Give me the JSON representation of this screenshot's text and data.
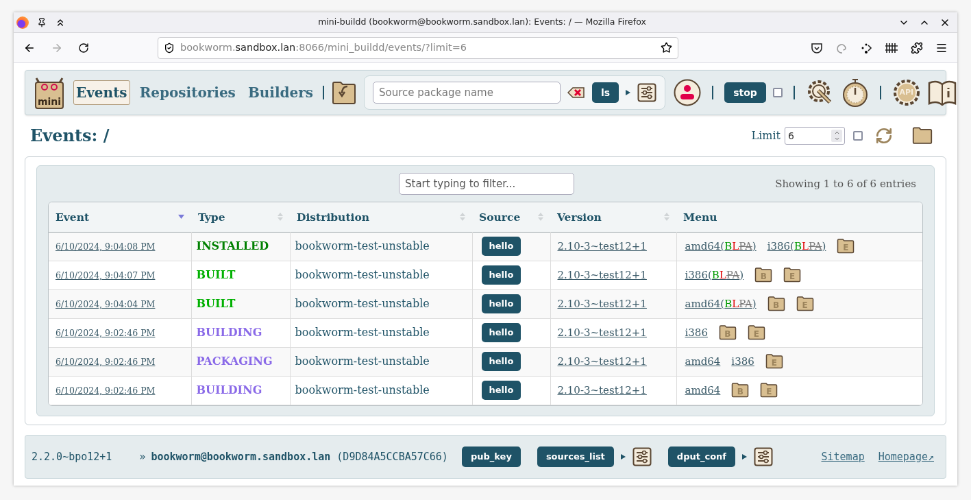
{
  "window": {
    "title": "mini-buildd (bookworm@bookworm.sandbox.lan): Events: / — Mozilla Firefox"
  },
  "browser": {
    "url_parts": [
      {
        "text": "bookworm.",
        "kind": "dim"
      },
      {
        "text": "sandbox.lan",
        "kind": "host"
      },
      {
        "text": ":8066/mini_buildd/events/?limit=6",
        "kind": "dim"
      }
    ]
  },
  "header": {
    "logo_text": "mini",
    "nav": [
      {
        "label": "Events",
        "selected": true
      },
      {
        "label": "Repositories",
        "selected": false
      },
      {
        "label": "Builders",
        "selected": false
      }
    ],
    "search": {
      "placeholder": "Source package name"
    },
    "ls_button": "ls",
    "stop_button": "stop",
    "stop_checked": false,
    "api_label": "API"
  },
  "page_title": "Events: /",
  "limit": {
    "label": "Limit",
    "value": "6",
    "checked": false
  },
  "table": {
    "filter_placeholder": "Start typing to filter...",
    "info": "Showing 1 to 6 of 6 entries",
    "columns": [
      {
        "label": "Event",
        "sortable": true,
        "sorted_desc": true
      },
      {
        "label": "Type",
        "sortable": true,
        "sorted_desc": false
      },
      {
        "label": "Distribution",
        "sortable": true,
        "sorted_desc": false
      },
      {
        "label": "Source",
        "sortable": true,
        "sorted_desc": false
      },
      {
        "label": "Version",
        "sortable": true,
        "sorted_desc": false
      },
      {
        "label": "Menu",
        "sortable": false
      }
    ],
    "rows": [
      {
        "event": "6/10/2024, 9:04:08 PM",
        "type": "INSTALLED",
        "color": "#008000",
        "distribution": "bookworm-test-unstable",
        "source": "hello",
        "version": "2.10-3~test12+1",
        "menu": [
          {
            "kind": "arch",
            "parts": [
              {
                "text": "amd64(",
                "kind": "plain"
              },
              {
                "text": "B",
                "kind": "ok"
              },
              {
                "text": "L",
                "kind": "fail"
              },
              {
                "text": "PA",
                "kind": "skip"
              },
              {
                "text": ")",
                "kind": "plain"
              }
            ]
          },
          {
            "kind": "arch",
            "parts": [
              {
                "text": "i386(",
                "kind": "plain"
              },
              {
                "text": "B",
                "kind": "ok"
              },
              {
                "text": "L",
                "kind": "fail"
              },
              {
                "text": "PA",
                "kind": "skip"
              },
              {
                "text": ")",
                "kind": "plain"
              }
            ]
          },
          {
            "kind": "folder",
            "letter": "E"
          }
        ]
      },
      {
        "event": "6/10/2024, 9:04:07 PM",
        "type": "BUILT",
        "color": "#00b000",
        "distribution": "bookworm-test-unstable",
        "source": "hello",
        "version": "2.10-3~test12+1",
        "menu": [
          {
            "kind": "arch",
            "parts": [
              {
                "text": "i386(",
                "kind": "plain"
              },
              {
                "text": "B",
                "kind": "ok"
              },
              {
                "text": "L",
                "kind": "fail"
              },
              {
                "text": "PA",
                "kind": "skip"
              },
              {
                "text": ")",
                "kind": "plain"
              }
            ]
          },
          {
            "kind": "folder",
            "letter": "B"
          },
          {
            "kind": "folder",
            "letter": "E"
          }
        ]
      },
      {
        "event": "6/10/2024, 9:04:04 PM",
        "type": "BUILT",
        "color": "#00b000",
        "distribution": "bookworm-test-unstable",
        "source": "hello",
        "version": "2.10-3~test12+1",
        "menu": [
          {
            "kind": "arch",
            "parts": [
              {
                "text": "amd64(",
                "kind": "plain"
              },
              {
                "text": "B",
                "kind": "ok"
              },
              {
                "text": "L",
                "kind": "fail"
              },
              {
                "text": "PA",
                "kind": "skip"
              },
              {
                "text": ")",
                "kind": "plain"
              }
            ]
          },
          {
            "kind": "folder",
            "letter": "B"
          },
          {
            "kind": "folder",
            "letter": "E"
          }
        ]
      },
      {
        "event": "6/10/2024, 9:02:46 PM",
        "type": "BUILDING",
        "color": "#8a6ae8",
        "distribution": "bookworm-test-unstable",
        "source": "hello",
        "version": "2.10-3~test12+1",
        "menu": [
          {
            "kind": "arch",
            "parts": [
              {
                "text": "i386",
                "kind": "plain"
              }
            ]
          },
          {
            "kind": "folder",
            "letter": "B"
          },
          {
            "kind": "folder",
            "letter": "E"
          }
        ]
      },
      {
        "event": "6/10/2024, 9:02:46 PM",
        "type": "PACKAGING",
        "color": "#8a6ae8",
        "distribution": "bookworm-test-unstable",
        "source": "hello",
        "version": "2.10-3~test12+1",
        "menu": [
          {
            "kind": "arch",
            "parts": [
              {
                "text": "amd64",
                "kind": "plain"
              }
            ]
          },
          {
            "kind": "arch",
            "parts": [
              {
                "text": "i386",
                "kind": "plain"
              }
            ]
          },
          {
            "kind": "folder",
            "letter": "E"
          }
        ]
      },
      {
        "event": "6/10/2024, 9:02:46 PM",
        "type": "BUILDING",
        "color": "#8a6ae8",
        "distribution": "bookworm-test-unstable",
        "source": "hello",
        "version": "2.10-3~test12+1",
        "menu": [
          {
            "kind": "arch",
            "parts": [
              {
                "text": "amd64",
                "kind": "plain"
              }
            ]
          },
          {
            "kind": "folder",
            "letter": "B"
          },
          {
            "kind": "folder",
            "letter": "E"
          }
        ]
      }
    ]
  },
  "footer": {
    "version": "2.2.0~bpo12+1",
    "arrow": "»",
    "user": "bookworm@bookworm.sandbox.lan",
    "key": "(D9D84A5CCBA57C66)",
    "buttons": [
      {
        "label": "pub_key",
        "options": false
      },
      {
        "label": "sources_list",
        "options": true
      },
      {
        "label": "dput_conf",
        "options": true
      }
    ],
    "links": [
      "Sitemap",
      "Homepage↗"
    ]
  }
}
